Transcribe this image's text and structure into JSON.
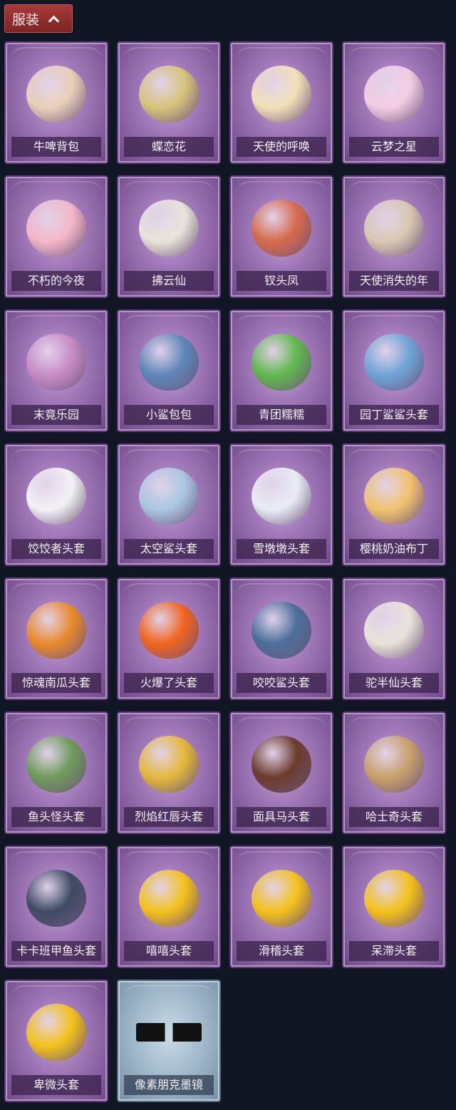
{
  "section": {
    "title": "服装"
  },
  "items": [
    {
      "name": "牛啤背包",
      "icon": "cow-beer-backpack-icon",
      "color": "#e9d0b8"
    },
    {
      "name": "蝶恋花",
      "icon": "butterfly-bell-ornament-icon",
      "color": "#d8c47a"
    },
    {
      "name": "天使的呼唤",
      "icon": "angel-figure-icon",
      "color": "#f2e0b8"
    },
    {
      "name": "云梦之星",
      "icon": "unicorn-cloud-star-icon",
      "color": "#f4cde4"
    },
    {
      "name": "不朽的今夜",
      "icon": "pink-cat-heart-icon",
      "color": "#f3b7c8"
    },
    {
      "name": "拂云仙",
      "icon": "fairy-charm-icon",
      "color": "#e8e3da"
    },
    {
      "name": "钗头凤",
      "icon": "phoenix-crown-doll-icon",
      "color": "#d66a4a"
    },
    {
      "name": "天使消失的年",
      "icon": "angel-doll-charm-icon",
      "color": "#d9c8b2"
    },
    {
      "name": "末竟乐园",
      "icon": "bunny-girl-doll-icon",
      "color": "#c88cc6"
    },
    {
      "name": "小鲨包包",
      "icon": "shark-bag-icon",
      "color": "#5d86b8"
    },
    {
      "name": "青团糯糯",
      "icon": "green-dumpling-icon",
      "color": "#5fb84d"
    },
    {
      "name": "园丁鲨鲨头套",
      "icon": "bee-shark-hood-icon",
      "color": "#6ea3d6"
    },
    {
      "name": "饺饺者头套",
      "icon": "dumpling-head-icon",
      "color": "#f2f2f4"
    },
    {
      "name": "太空鲨头套",
      "icon": "space-shark-head-icon",
      "color": "#a9c6e0"
    },
    {
      "name": "雪墩墩头套",
      "icon": "snowman-head-icon",
      "color": "#e9edf5"
    },
    {
      "name": "樱桃奶油布丁",
      "icon": "pudding-head-icon",
      "color": "#f2c36e"
    },
    {
      "name": "惊魂南瓜头套",
      "icon": "pumpkin-head-icon",
      "color": "#e98a2c"
    },
    {
      "name": "火爆了头套",
      "icon": "fire-head-icon",
      "color": "#f0641e"
    },
    {
      "name": "咬咬鲨头套",
      "icon": "biting-shark-head-icon",
      "color": "#4a6f9a"
    },
    {
      "name": "驼半仙头套",
      "icon": "bear-sunglasses-head-icon",
      "color": "#e9e2da"
    },
    {
      "name": "鱼头怪头套",
      "icon": "fish-monster-head-icon",
      "color": "#6f9a5a"
    },
    {
      "name": "烈焰红唇头套",
      "icon": "red-lips-head-icon",
      "color": "#e5b83a"
    },
    {
      "name": "面具马头套",
      "icon": "horse-mask-head-icon",
      "color": "#6b3a2a"
    },
    {
      "name": "哈士奇头套",
      "icon": "husky-head-icon",
      "color": "#c8a06a"
    },
    {
      "name": "卡卡班甲鱼头套",
      "icon": "armored-fish-head-icon",
      "color": "#3e4a64"
    },
    {
      "name": "嘻嘻头套",
      "icon": "grin-emoji-head-icon",
      "color": "#f4c21a"
    },
    {
      "name": "滑稽头套",
      "icon": "funny-emoji-head-icon",
      "color": "#f4c21a"
    },
    {
      "name": "呆滞头套",
      "icon": "stunned-emoji-head-icon",
      "color": "#f4c21a"
    },
    {
      "name": "卑微头套",
      "icon": "timid-emoji-head-icon",
      "color": "#f4c21a"
    },
    {
      "name": "像素朋克墨镜",
      "icon": "pixel-sunglasses-icon",
      "color": "#111111",
      "variant": "blue"
    }
  ]
}
